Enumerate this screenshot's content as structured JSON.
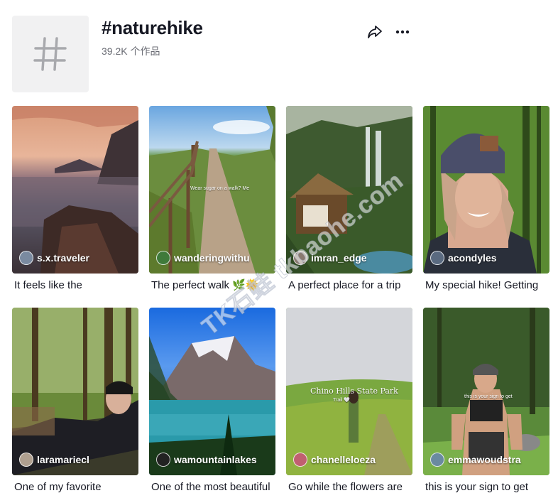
{
  "hashtag": {
    "title": "#naturehike",
    "count": "39.2K 个作品",
    "avatar_icon": "hashtag-icon",
    "share_icon": "share-icon",
    "more_icon": "more-icon"
  },
  "videos": [
    {
      "author": "s.x.traveler",
      "caption": "It feels like the",
      "avatar_color": "#7a8aa0"
    },
    {
      "author": "wanderingwithu",
      "caption": "The perfect walk 🌿🌞",
      "avatar_color": "#3f7a3a",
      "overlay": "Wear sugar on a walk? Me"
    },
    {
      "author": "imran_edge",
      "caption": "A perfect place for a trip",
      "avatar_color": "#8a7a70"
    },
    {
      "author": "acondyles",
      "caption": "My special hike! Getting",
      "avatar_color": "#5a6a80"
    },
    {
      "author": "laramariecl",
      "caption": "One of my favorite",
      "avatar_color": "#b0a090"
    },
    {
      "author": "wamountainlakes",
      "caption": "One of the most beautiful",
      "avatar_color": "#222222"
    },
    {
      "author": "chanelleloeza",
      "caption": "Go while the flowers are",
      "avatar_color": "#c06070",
      "overlay": "Chino Hills State Park",
      "overlay2": "Trail 🤍"
    },
    {
      "author": "emmawoudstra",
      "caption": "this is your sign to get",
      "avatar_color": "#6a8aa0",
      "overlay": "this is your sign to get"
    }
  ],
  "watermark": "TK石蛙 tkbaohe.com"
}
